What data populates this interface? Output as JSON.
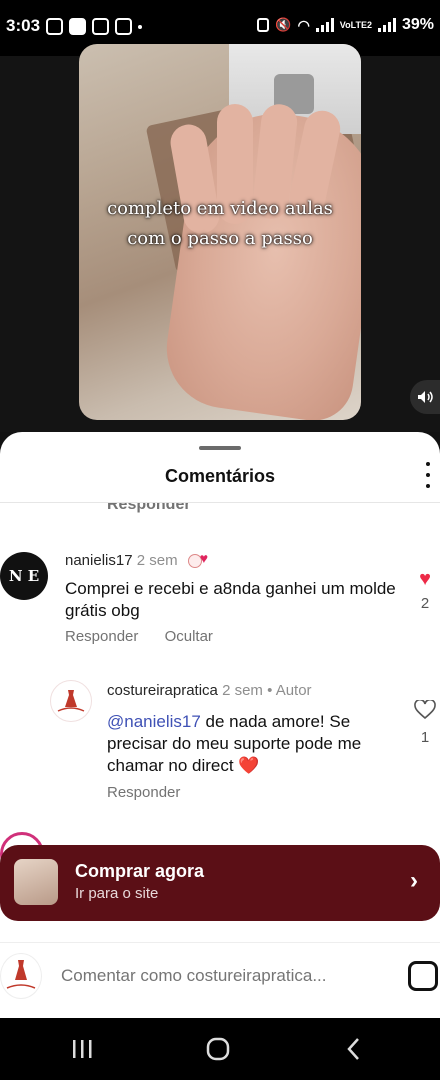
{
  "status_bar": {
    "time": "3:03",
    "battery": "39%",
    "network": "VoLTE2"
  },
  "video": {
    "caption_line1": "completo em video aulas",
    "caption_line2": "com o passo a passo"
  },
  "comments_sheet": {
    "title": "Comentários",
    "previous_reply_label": "Responder",
    "comments": [
      {
        "username": "nanielis17",
        "time": "2 sem",
        "avatar_text": "N E",
        "text": "Comprei e recebi  e a8nda ganhei um molde grátis obg",
        "reply_label": "Responder",
        "hide_label": "Ocultar",
        "liked": true,
        "likes": "2"
      },
      {
        "username": "costureirapratica",
        "time": "2 sem",
        "author_label": "Autor",
        "mention": "@nanielis17",
        "text": " de nada amore! Se precisar do meu suporte pode me chamar no direct ❤️",
        "reply_label": "Responder",
        "liked": false,
        "likes": "1"
      }
    ]
  },
  "purchase": {
    "title": "Comprar agora",
    "subtitle": "Ir para o site"
  },
  "comment_input": {
    "placeholder": "Comentar como costureirapratica..."
  },
  "colors": {
    "heart_red": "#ed2a47",
    "mention_blue": "#3f51b5",
    "banner": "#5b0f16"
  }
}
